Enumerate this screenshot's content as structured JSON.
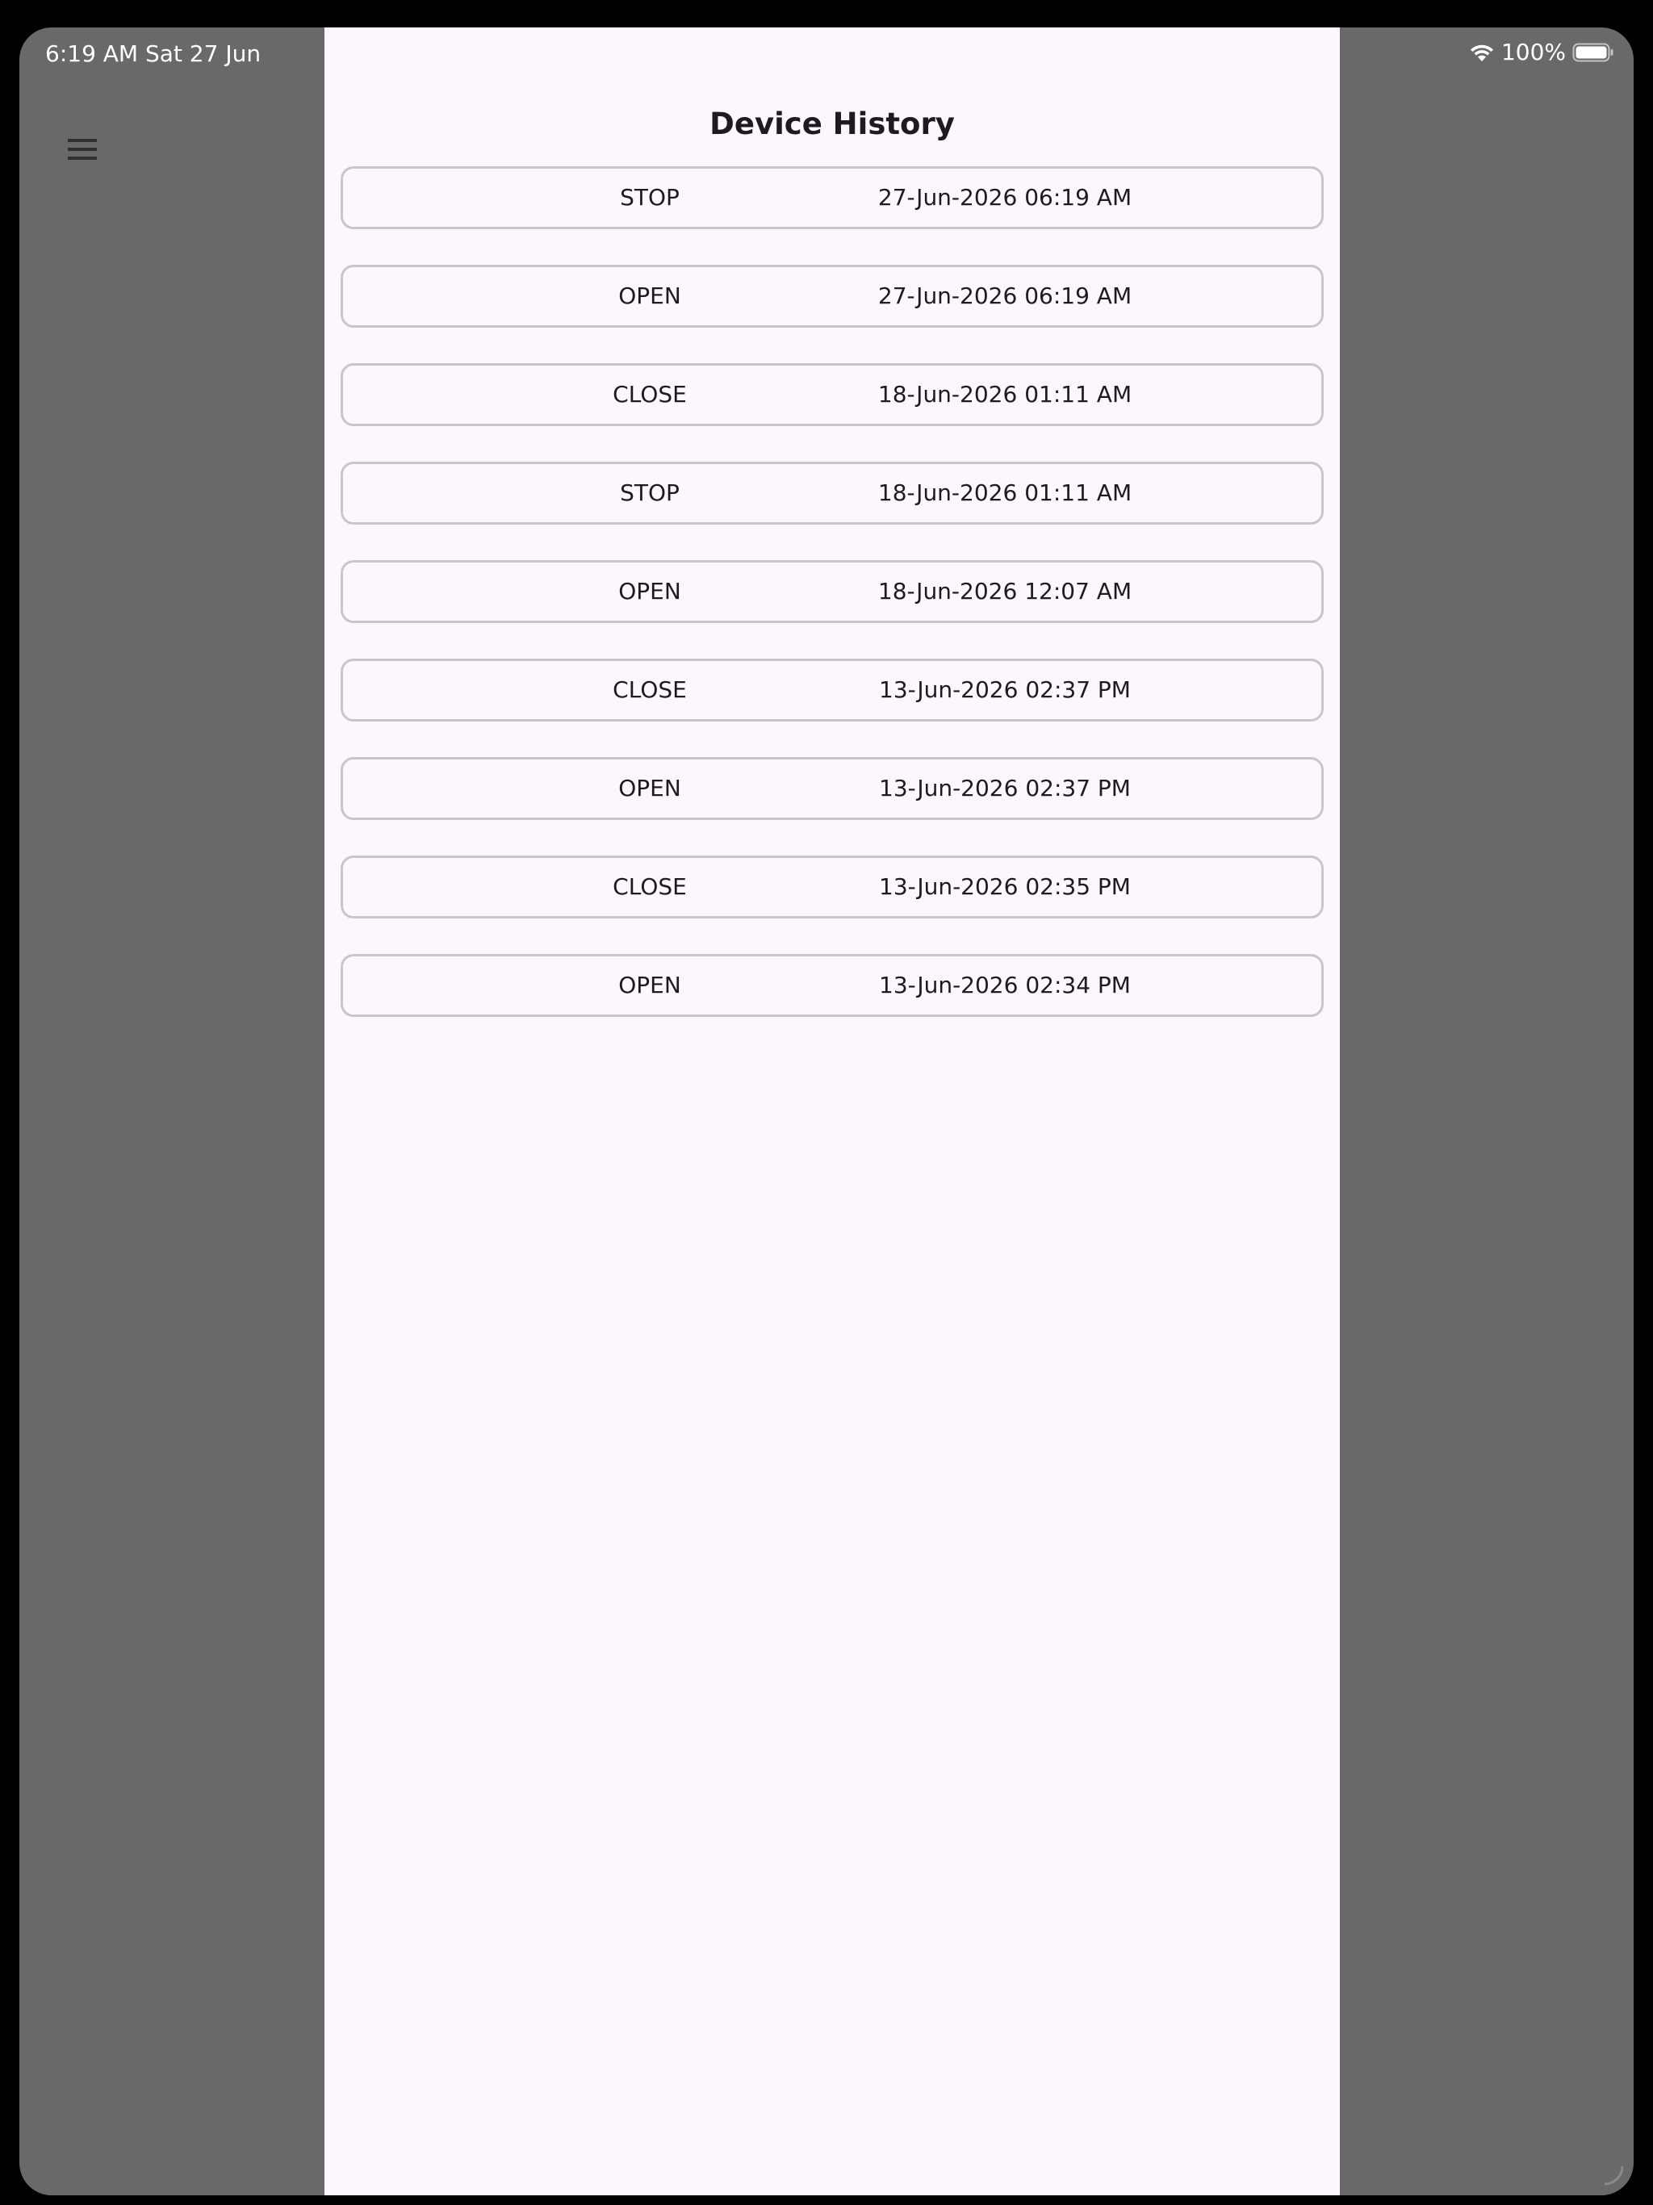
{
  "status_bar": {
    "time": "6:19 AM",
    "date": "Sat 27 Jun",
    "battery": "100%",
    "wifi_icon": "wifi-icon",
    "battery_icon": "battery-full-icon"
  },
  "navigation": {
    "menu_icon": "hamburger-menu-icon"
  },
  "sheet": {
    "title": "Device History",
    "rows": [
      {
        "action": "STOP",
        "time": "27-Jun-2026 06:19 AM"
      },
      {
        "action": "OPEN",
        "time": "27-Jun-2026 06:19 AM"
      },
      {
        "action": "CLOSE",
        "time": "18-Jun-2026 01:11 AM"
      },
      {
        "action": "STOP",
        "time": "18-Jun-2026 01:11 AM"
      },
      {
        "action": "OPEN",
        "time": "18-Jun-2026 12:07 AM"
      },
      {
        "action": "CLOSE",
        "time": "13-Jun-2026 02:37 PM"
      },
      {
        "action": "OPEN",
        "time": "13-Jun-2026 02:37 PM"
      },
      {
        "action": "CLOSE",
        "time": "13-Jun-2026 02:35 PM"
      },
      {
        "action": "OPEN",
        "time": "13-Jun-2026 02:34 PM"
      }
    ]
  },
  "colors": {
    "scrim": "#696969",
    "sheet_background": "#fdf6fd",
    "row_border": "#cac4d0",
    "text": "#1d1b20"
  }
}
